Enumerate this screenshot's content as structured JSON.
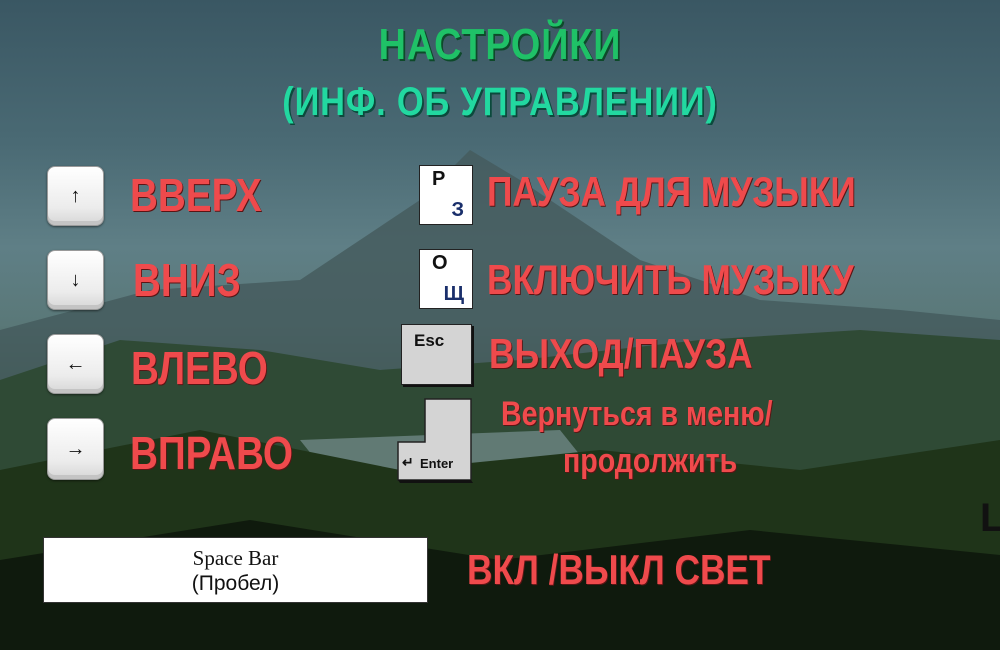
{
  "title": {
    "line1": "НАСТРОЙКИ",
    "line2": "(ИНФ. ОБ УПРАВЛЕНИИ)"
  },
  "controls": [
    {
      "key_icon": "arrow-up-icon",
      "glyph": "↑",
      "action": "ВВЕРХ"
    },
    {
      "key_icon": "arrow-down-icon",
      "glyph": "↓",
      "action": "ВНИЗ"
    },
    {
      "key_icon": "arrow-left-icon",
      "glyph": "←",
      "action": "ВЛЕВО"
    },
    {
      "key_icon": "arrow-right-icon",
      "glyph": "→",
      "action": "ВПРАВО"
    }
  ],
  "keys": {
    "p": {
      "latin": "P",
      "cyrillic": "З",
      "action": "ПАУЗА ДЛЯ МУЗЫКИ"
    },
    "o": {
      "latin": "O",
      "cyrillic": "Щ",
      "action": "ВКЛЮЧИТЬ МУЗЫКУ"
    },
    "esc": {
      "label": "Esc",
      "action": "ВЫХОД/ПАУЗА"
    },
    "enter": {
      "label": "Enter",
      "symbol": "↵",
      "action_line1": "Вернуться в меню/",
      "action_line2": "продолжить"
    },
    "space": {
      "line1": "Space Bar",
      "line2": "(Пробел)",
      "action": "ВКЛ /ВЫКЛ СВЕТ"
    }
  },
  "partial_text": "Le",
  "colors": {
    "title1": "#1fc167",
    "title2": "#22d8a0",
    "action": "#ef4a4c"
  }
}
